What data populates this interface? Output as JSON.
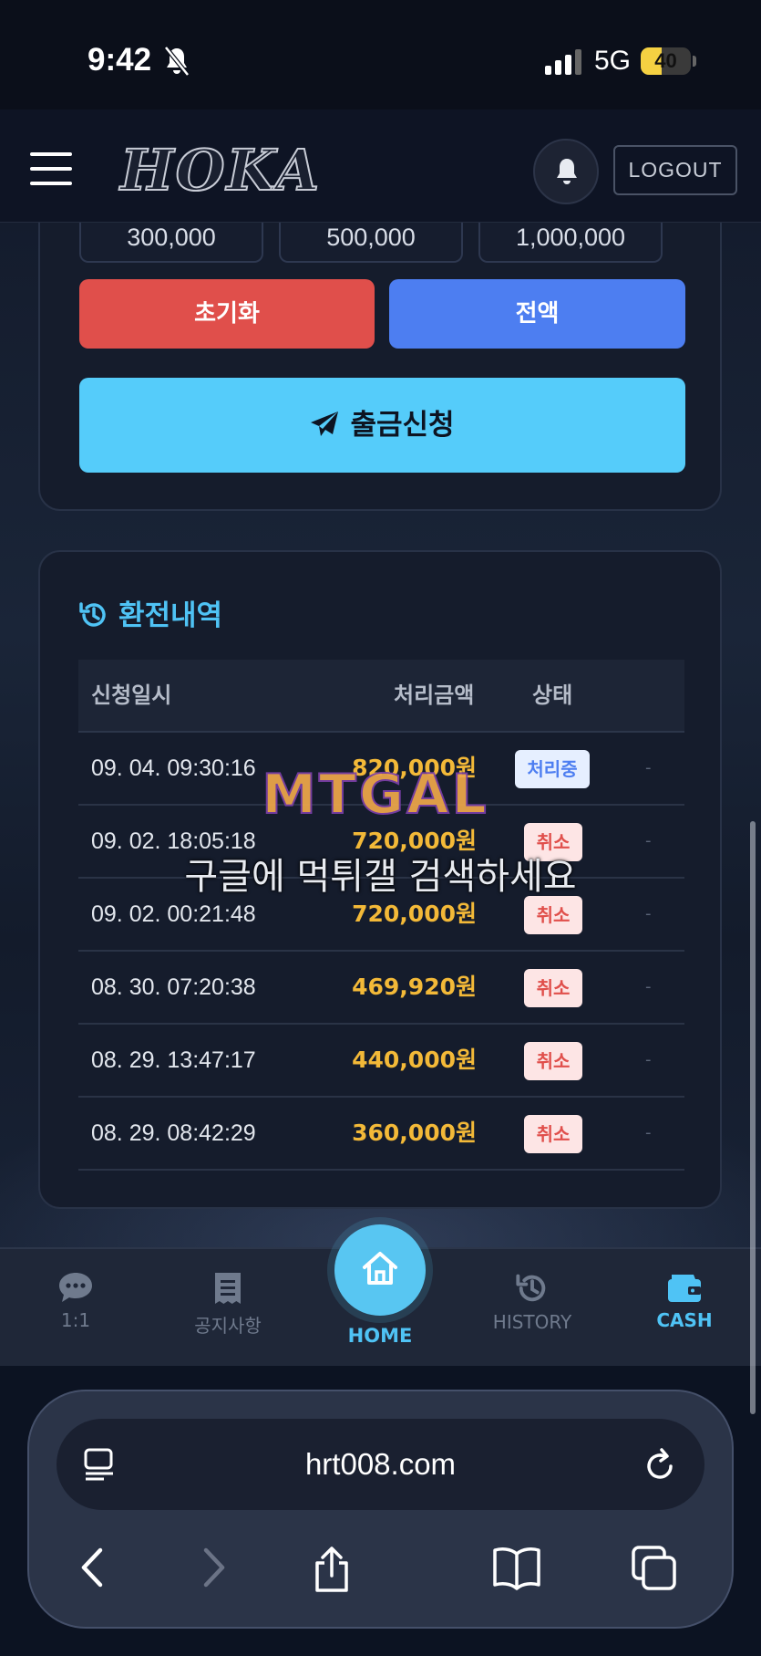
{
  "status_bar": {
    "time": "9:42",
    "network": "5G",
    "battery_level": "40"
  },
  "header": {
    "logo_text": "HOKA",
    "logout_label": "LOGOUT"
  },
  "withdraw_form": {
    "amount_buttons": [
      "300,000",
      "500,000",
      "1,000,000"
    ],
    "reset_label": "초기화",
    "all_label": "전액",
    "submit_label": "출금신청"
  },
  "history": {
    "title": "환전내역",
    "columns": {
      "date": "신청일시",
      "amount": "처리금액",
      "status": "상태"
    },
    "rows": [
      {
        "date": "09. 04. 09:30:16",
        "amount": "820,000원",
        "status": "처리중",
        "extra": "-"
      },
      {
        "date": "09. 02. 18:05:18",
        "amount": "720,000원",
        "status": "취소",
        "extra": "-"
      },
      {
        "date": "09. 02. 00:21:48",
        "amount": "720,000원",
        "status": "취소",
        "extra": "-"
      },
      {
        "date": "08. 30. 07:20:38",
        "amount": "469,920원",
        "status": "취소",
        "extra": "-"
      },
      {
        "date": "08. 29. 13:47:17",
        "amount": "440,000원",
        "status": "취소",
        "extra": "-"
      },
      {
        "date": "08. 29. 08:42:29",
        "amount": "360,000원",
        "status": "취소",
        "extra": "-"
      }
    ]
  },
  "watermark": {
    "logo": "MTGAL",
    "text": "구글에 먹튀갤 검색하세요"
  },
  "bottom_nav": {
    "chat": "1:1",
    "notice": "공지사항",
    "home": "HOME",
    "history": "HISTORY",
    "cash": "CASH"
  },
  "browser": {
    "url": "hrt008.com"
  },
  "colors": {
    "accent": "#4fc3f5",
    "reset": "#e04f4b",
    "all": "#4d7ef1",
    "amount": "#f3b938"
  }
}
